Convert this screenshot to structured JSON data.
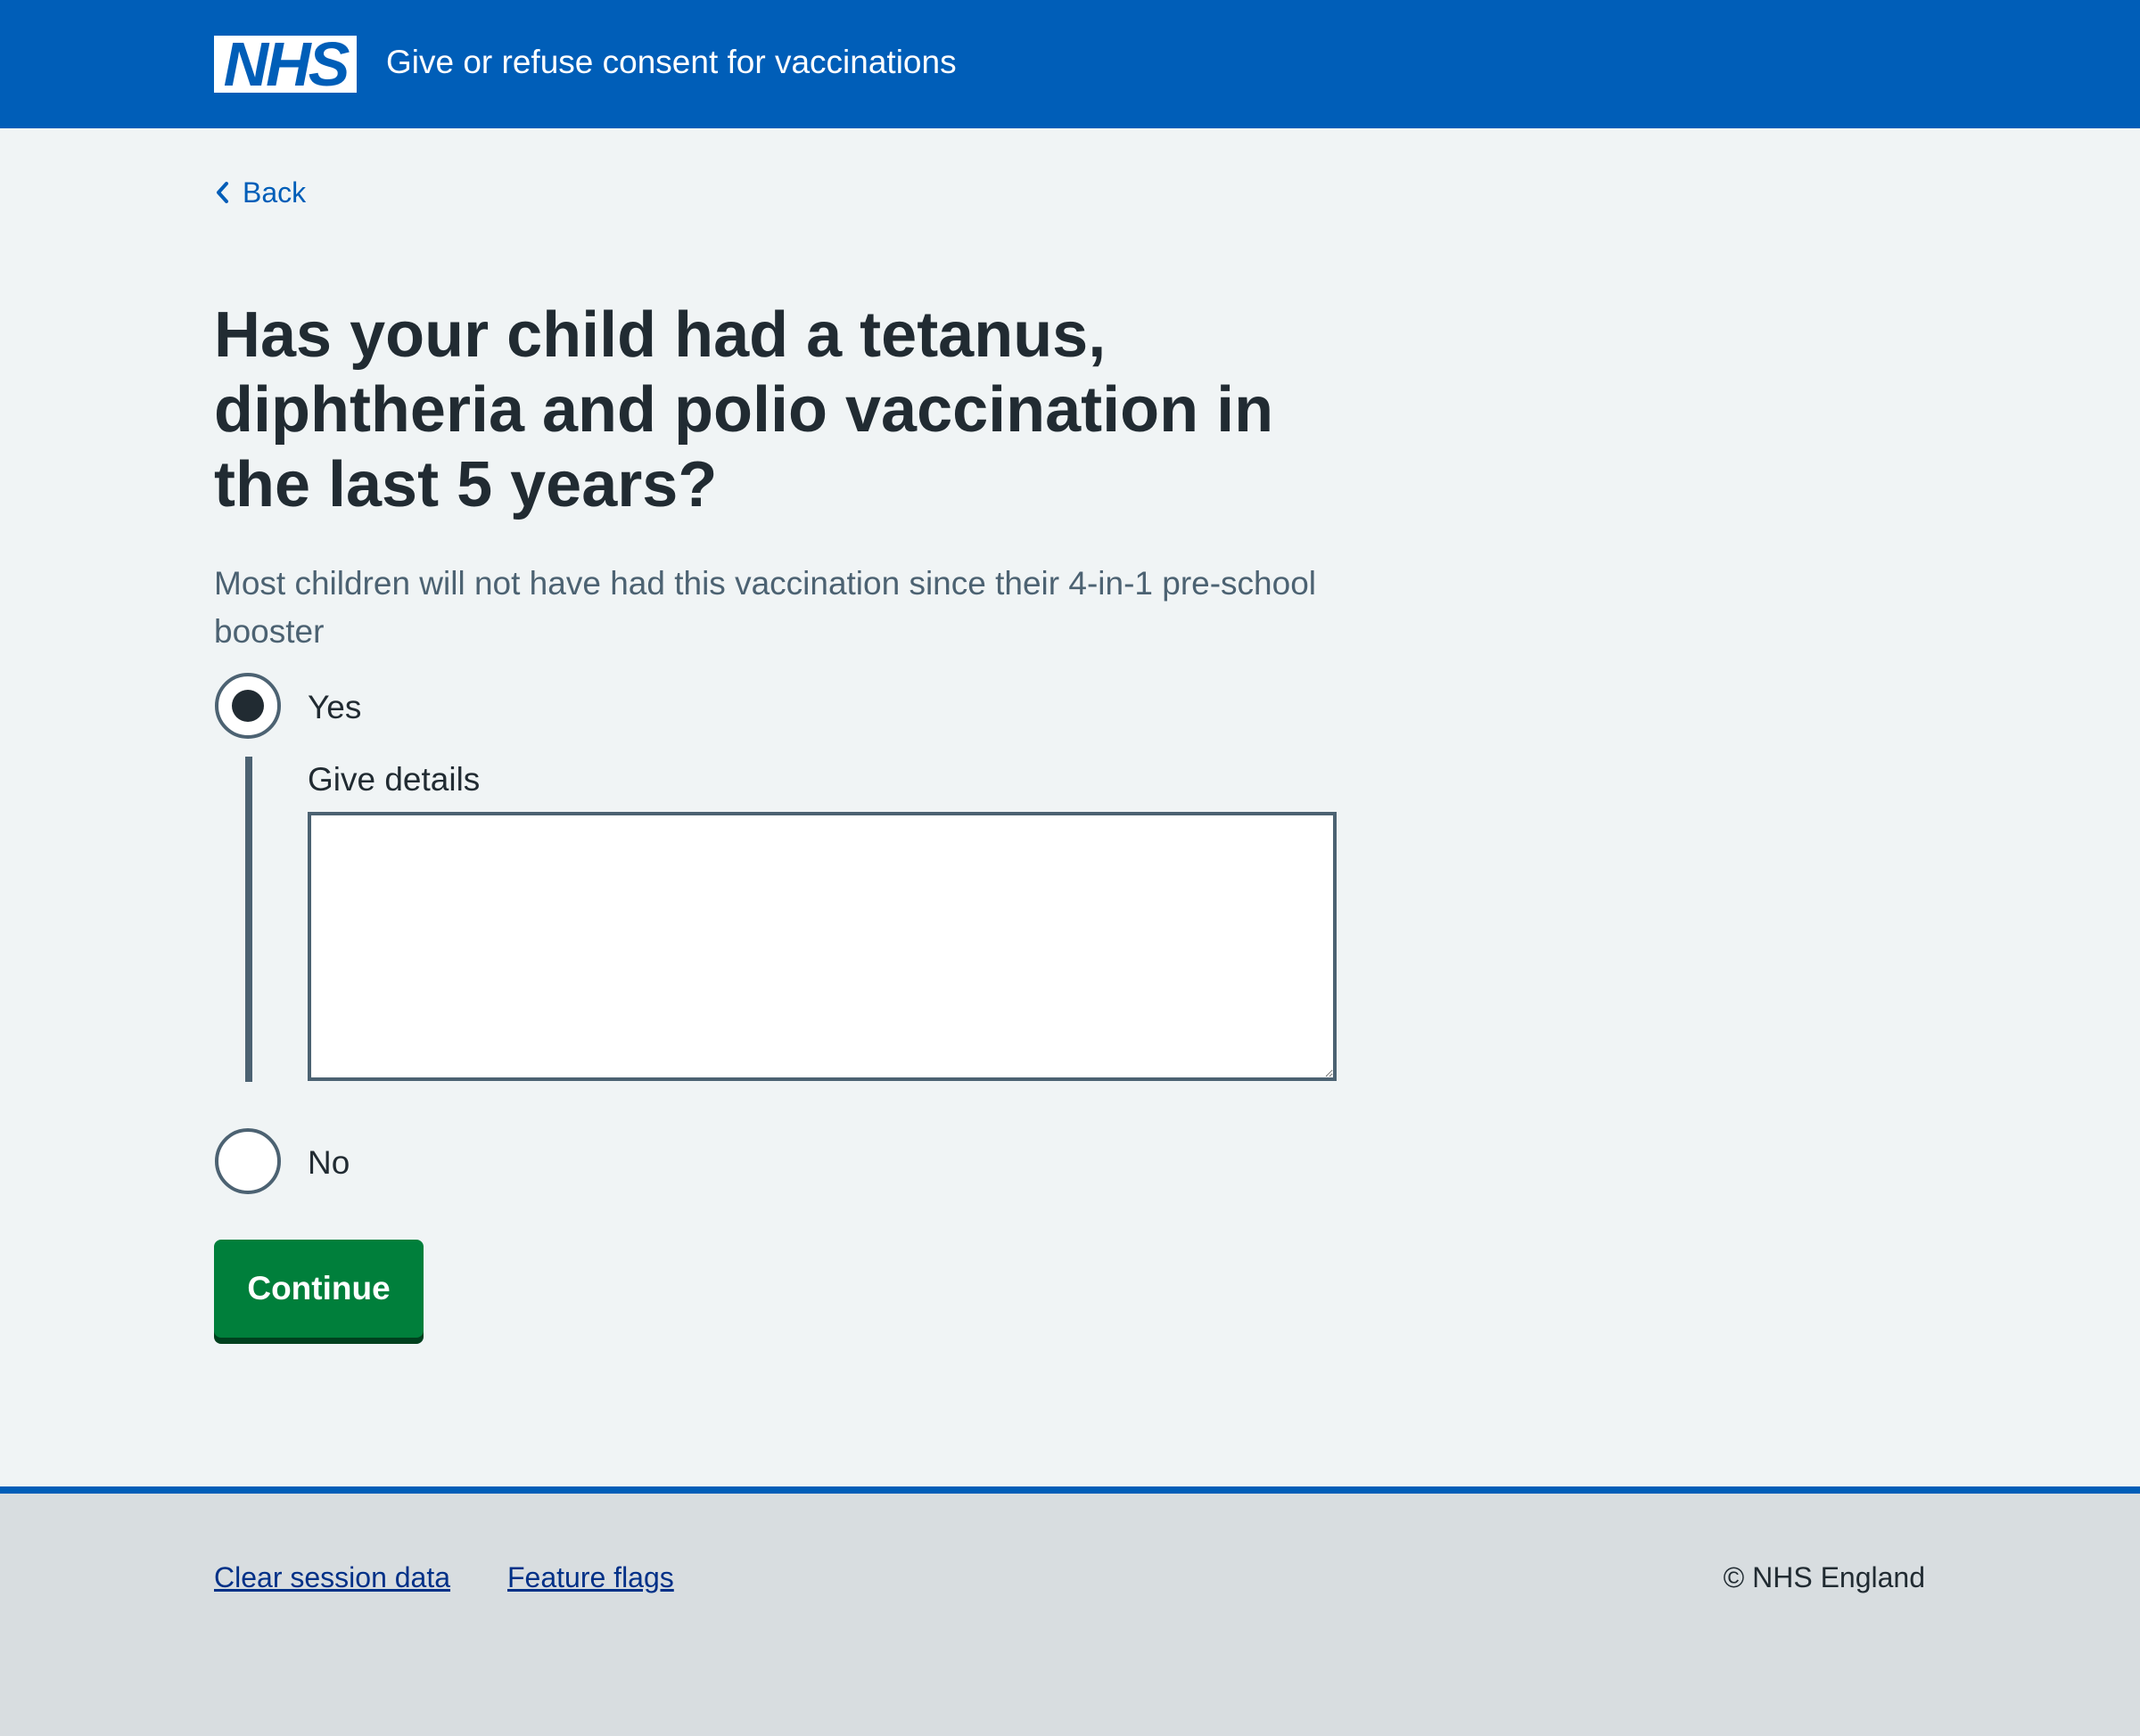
{
  "header": {
    "logo_text": "NHS",
    "service_name": "Give or refuse consent for vaccinations",
    "background_color": "#005eb8"
  },
  "nav": {
    "back_label": "Back",
    "back_icon": "chevron-left-icon"
  },
  "question": {
    "heading": "Has your child had a tetanus, diphtheria and polio vaccination in the last 5 years?",
    "hint": "Most children will not have had this vaccination since their 4-in-1 pre-school booster",
    "options": [
      {
        "label": "Yes",
        "selected": true
      },
      {
        "label": "No",
        "selected": false
      }
    ],
    "details_label": "Give details",
    "details_value": ""
  },
  "actions": {
    "continue_label": "Continue",
    "continue_color": "#007f3b"
  },
  "footer": {
    "links": [
      {
        "label": "Clear session data"
      },
      {
        "label": "Feature flags"
      }
    ],
    "copyright": "© NHS England"
  }
}
